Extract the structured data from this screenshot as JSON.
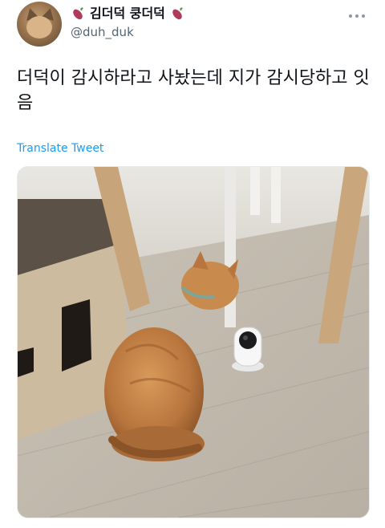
{
  "user": {
    "display_name": "김더덕 쿵더덕",
    "handle": "@duh_duk",
    "name_emoji": "sweet-potato-icon"
  },
  "tweet": {
    "text": "더덕이 감시하라고 사놨는데 지가 감시당하고 잇음",
    "translate_label": "Translate Tweet"
  },
  "menu": {
    "more_icon": "more-options-icon"
  },
  "colors": {
    "link": "#1d9bf0",
    "secondary_text": "#536471",
    "primary_text": "#0f1419",
    "background": "#ffffff"
  }
}
